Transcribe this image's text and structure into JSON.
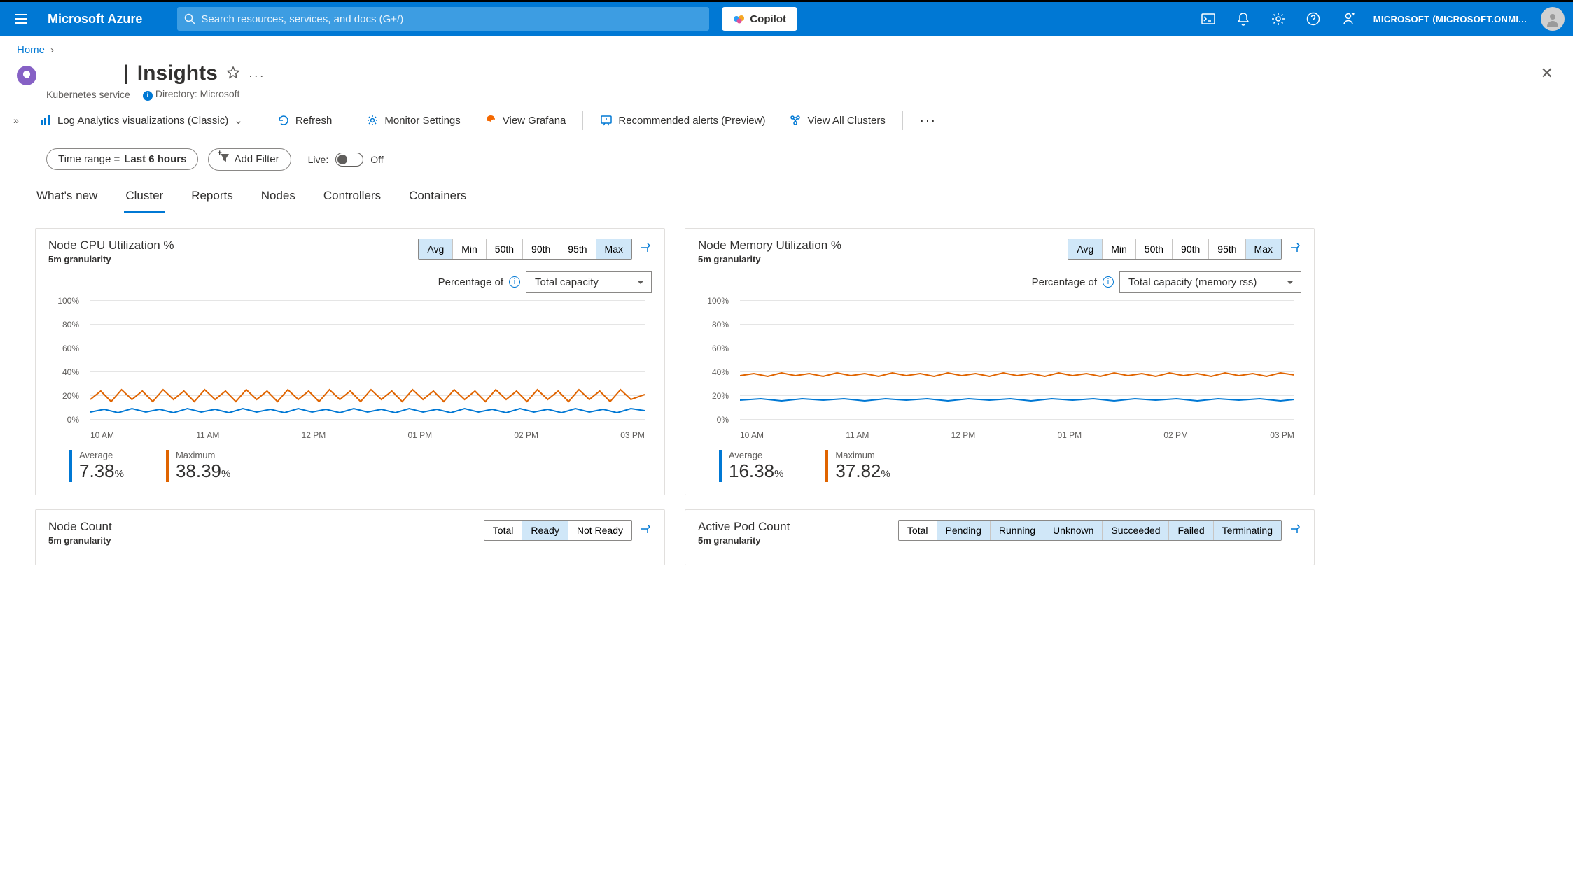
{
  "header": {
    "brand": "Microsoft Azure",
    "search_placeholder": "Search resources, services, and docs (G+/)",
    "copilot": "Copilot",
    "tenant": "MICROSOFT (MICROSOFT.ONMI..."
  },
  "breadcrumb": {
    "home": "Home"
  },
  "page": {
    "title": "Insights",
    "subtitle1": "Kubernetes service",
    "directory": "Directory: Microsoft"
  },
  "toolbar": {
    "log_analytics": "Log Analytics visualizations (Classic)",
    "refresh": "Refresh",
    "monitor_settings": "Monitor Settings",
    "view_grafana": "View Grafana",
    "rec_alerts": "Recommended alerts (Preview)",
    "view_all_clusters": "View All Clusters"
  },
  "filters": {
    "time_label": "Time range = ",
    "time_value": "Last 6 hours",
    "add_filter": "Add Filter",
    "live_label": "Live:",
    "live_state": "Off"
  },
  "tabs": [
    "What's new",
    "Cluster",
    "Reports",
    "Nodes",
    "Controllers",
    "Containers"
  ],
  "seg_options": [
    "Avg",
    "Min",
    "50th",
    "90th",
    "95th",
    "Max"
  ],
  "node_count_options": [
    "Total",
    "Ready",
    "Not Ready"
  ],
  "pod_count_options": [
    "Total",
    "Pending",
    "Running",
    "Unknown",
    "Succeeded",
    "Failed",
    "Terminating"
  ],
  "percentage_label": "Percentage of",
  "cpu": {
    "title": "Node CPU Utilization %",
    "granularity": "5m granularity",
    "dropdown": "Total capacity",
    "avg_label": "Average",
    "avg": "7.38",
    "avg_unit": "%",
    "max_label": "Maximum",
    "max": "38.39",
    "max_unit": "%"
  },
  "mem": {
    "title": "Node Memory Utilization %",
    "granularity": "5m granularity",
    "dropdown": "Total capacity (memory rss)",
    "avg_label": "Average",
    "avg": "16.38",
    "avg_unit": "%",
    "max_label": "Maximum",
    "max": "37.82",
    "max_unit": "%"
  },
  "node_count": {
    "title": "Node Count",
    "granularity": "5m granularity"
  },
  "pod_count": {
    "title": "Active Pod Count",
    "granularity": "5m granularity"
  },
  "ylabels": [
    "100%",
    "80%",
    "60%",
    "40%",
    "20%",
    "0%"
  ],
  "xlabels": [
    "10 AM",
    "11 AM",
    "12 PM",
    "01 PM",
    "02 PM",
    "03 PM"
  ],
  "chart_data": [
    {
      "type": "line",
      "title": "Node CPU Utilization %",
      "xlabel": "",
      "ylabel": "",
      "ylim": [
        0,
        100
      ],
      "x": [
        "10 AM",
        "11 AM",
        "12 PM",
        "01 PM",
        "02 PM",
        "03 PM"
      ],
      "series": [
        {
          "name": "Average",
          "color": "#0078d4",
          "approx_value": 7.38
        },
        {
          "name": "Maximum",
          "color": "#e06400",
          "approx_value": 38.39,
          "range": [
            15,
            25
          ]
        }
      ],
      "granularity": "5m"
    },
    {
      "type": "line",
      "title": "Node Memory Utilization %",
      "xlabel": "",
      "ylabel": "",
      "ylim": [
        0,
        100
      ],
      "x": [
        "10 AM",
        "11 AM",
        "12 PM",
        "01 PM",
        "02 PM",
        "03 PM"
      ],
      "series": [
        {
          "name": "Average",
          "color": "#0078d4",
          "approx_value": 16.38
        },
        {
          "name": "Maximum",
          "color": "#e06400",
          "approx_value": 37.82,
          "range": [
            35,
            38
          ]
        }
      ],
      "granularity": "5m"
    }
  ]
}
